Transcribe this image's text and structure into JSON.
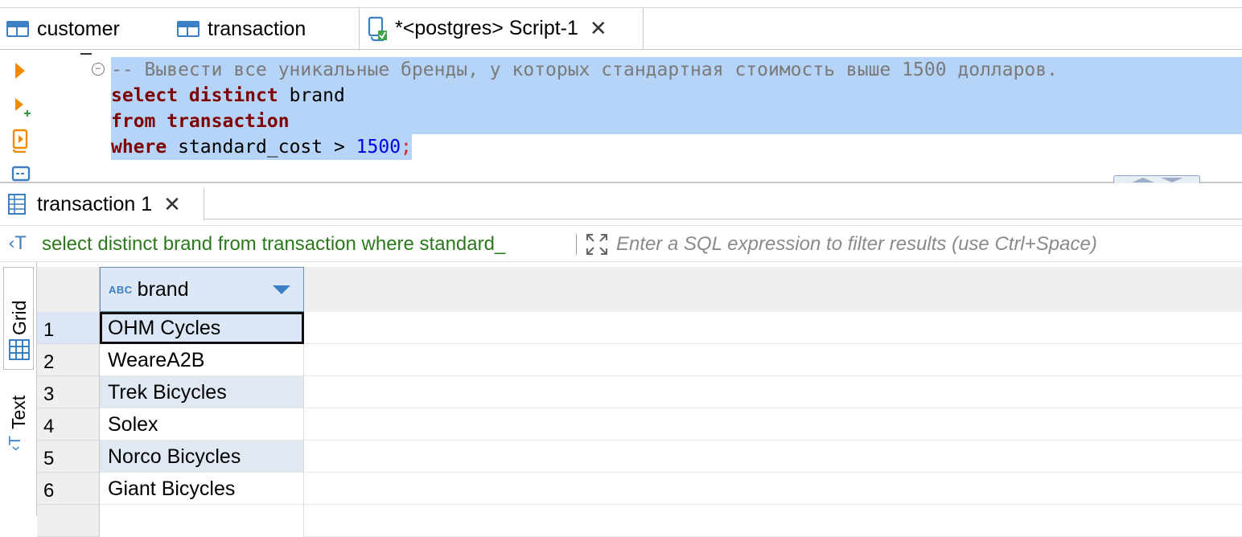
{
  "editor_tabs": [
    {
      "label": "customer"
    },
    {
      "label": "transaction"
    },
    {
      "label": "*<postgres> Script-1"
    }
  ],
  "editor": {
    "comment": "-- Вывести все уникальные бренды, у которых стандартная стоимость выше 1500 долларов.",
    "line2_kw": "select distinct",
    "line2_rest": " brand",
    "line3_kw": "from transaction",
    "line4_kw": "where",
    "line4_rest": " standard_cost > ",
    "line4_num": "1500",
    "line4_semi": ";"
  },
  "result_tab": {
    "label": "transaction 1"
  },
  "filter": {
    "query": "select distinct brand from transaction where standard_",
    "placeholder": "Enter a SQL expression to filter results (use Ctrl+Space)"
  },
  "side_tabs": {
    "grid": "Grid",
    "text": "Text"
  },
  "grid": {
    "type_badge": "ABC",
    "column": "brand",
    "rows": [
      {
        "n": "1",
        "brand": "OHM Cycles"
      },
      {
        "n": "2",
        "brand": "WeareA2B"
      },
      {
        "n": "3",
        "brand": "Trek Bicycles"
      },
      {
        "n": "4",
        "brand": "Solex"
      },
      {
        "n": "5",
        "brand": "Norco Bicycles"
      },
      {
        "n": "6",
        "brand": "Giant Bicycles"
      }
    ]
  },
  "colors": {
    "selection": "#b6d4f7",
    "keyword": "#7f0000",
    "number": "#0000e6",
    "filter_query": "#2a7a1c",
    "accent": "#3d7fc4"
  }
}
